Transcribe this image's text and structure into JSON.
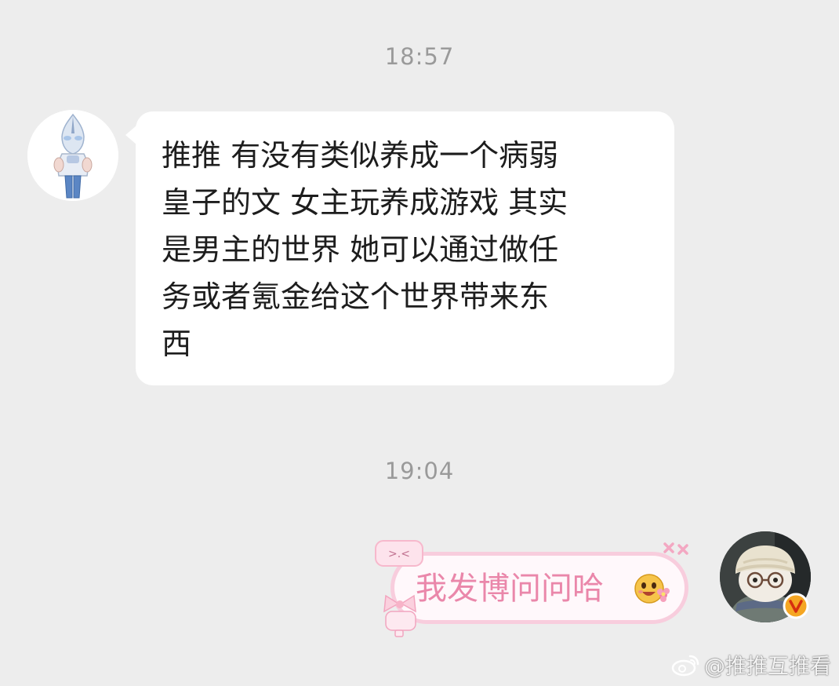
{
  "chat": {
    "timestamps": [
      "18:57",
      "19:04"
    ],
    "incoming": {
      "lines": [
        "推推 有没有类似养成一个病弱",
        "皇子的文 女主玩养成游戏 其实",
        "是男主的世界 她可以通过做任",
        "务或者氪金给这个世界带来东",
        "西"
      ]
    },
    "outgoing": {
      "text": "我发博问问哈",
      "sticker_text": ">.<",
      "emoji": "smiling-face-with-flower-emoji"
    }
  },
  "watermark": {
    "text": "@推推互推看",
    "icon": "weibo-logo-icon"
  },
  "colors": {
    "background": "#ededed",
    "incoming_bubble": "#ffffff",
    "outgoing_text": "#ea87aa",
    "outgoing_border": "#f8cddd",
    "timestamp": "#9a9a9a",
    "verified_badge": "#f5a623"
  }
}
